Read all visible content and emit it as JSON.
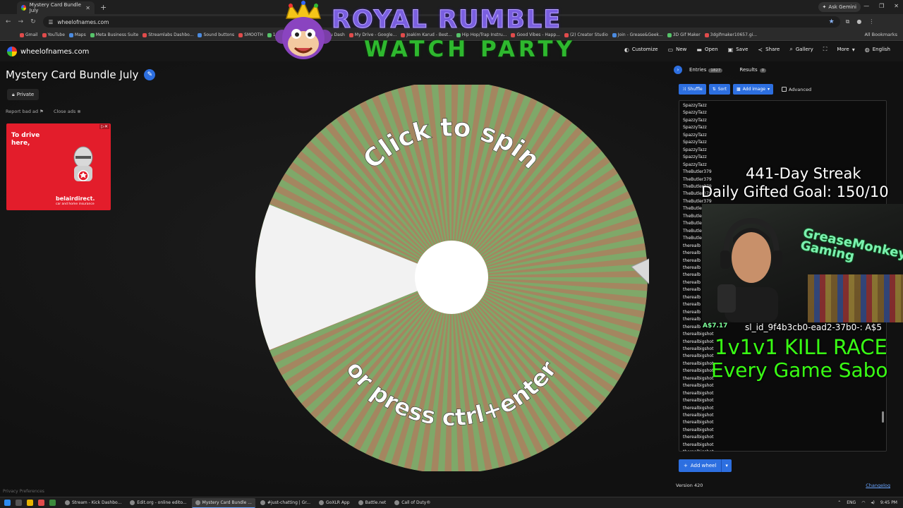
{
  "browser": {
    "tab_title": "Mystery Card Bundle July",
    "url": "wheelofnames.com",
    "ask_gemini": "Ask Gemini",
    "bookmarks": [
      "Gmail",
      "YouTube",
      "Maps",
      "Meta Business Suite",
      "Streamlabs Dashbo...",
      "Sound buttons",
      "SMOOTH",
      "10 HOUR GAMING...",
      "Juju Dash",
      "My Drive - Google...",
      "Joakim Karud - Best...",
      "Hip Hop/Trap Instru...",
      "Good Vibes - Happ...",
      "(2) Creator Studio",
      "Join - Grease&Geek...",
      "3D Gif Maker",
      "3dgifmaker10657.gi..."
    ],
    "all_bookmarks": "All Bookmarks"
  },
  "site": {
    "name": "wheelofnames.com",
    "menu": [
      "Customize",
      "New",
      "Open",
      "Save",
      "Share",
      "Gallery",
      "More",
      "English"
    ]
  },
  "wheel_page": {
    "title": "Mystery Card Bundle July",
    "private": "Private",
    "report_ad": "Report bad ad",
    "close_ads": "Close ads",
    "privacy": "Privacy Preferences",
    "spin_top": "Click to spin",
    "spin_bottom": "or press ctrl+enter"
  },
  "ad": {
    "text": "To drive here,",
    "brand": "belairdirect.",
    "tagline": "car and home insurance"
  },
  "panel": {
    "entries_tab": "Entries",
    "entries_count": "1827",
    "results_tab": "Results",
    "results_count": "0",
    "shuffle": "Shuffle",
    "sort": "Sort",
    "add_image": "Add image",
    "advanced": "Advanced",
    "add_wheel": "Add wheel",
    "version": "Version 420",
    "changelog": "Changelog"
  },
  "entries": [
    "SpazzyTazz",
    "SpazzyTazz",
    "SpazzyTazz",
    "SpazzyTazz",
    "SpazzyTazz",
    "SpazzyTazz",
    "SpazzyTazz",
    "SpazzyTazz",
    "SpazzyTazz",
    "TheButler379",
    "TheButler379",
    "TheButler379",
    "TheButler379",
    "TheButler379",
    "TheButle",
    "TheButle",
    "TheButle",
    "TheButle",
    "TheButle",
    "therealb",
    "therealb",
    "therealb",
    "therealb",
    "therealb",
    "therealb",
    "therealb",
    "therealb",
    "therealb",
    "therealb",
    "therealb",
    "therealb",
    "therealbigshot",
    "therealbigshot",
    "therealbigshot",
    "therealbigshot",
    "therealbigshot",
    "therealbigshot",
    "therealbigshot",
    "therealbigshot",
    "therealbigshot",
    "therealbigshot",
    "therealbigshot",
    "therealbigshot",
    "therealbigshot",
    "therealbigshot",
    "therealbigshot",
    "therealbigshot",
    "therealbigshot"
  ],
  "stream": {
    "title": "ROYAL RUMBLE",
    "subtitle": "WATCH PARTY",
    "streak": "441-Day Streak",
    "goal": "Daily Gifted Goal: 150/10",
    "cam_brand": "GreaseMonkey Gaming",
    "tip": "A$7.17",
    "ticker": "sl_id_9f4b3cb0-ead2-37b0-: A$5",
    "race_line1": "1v1v1 KILL RACE",
    "race_line2": "Every Game Sabo"
  },
  "taskbar": {
    "apps": [
      "Stream - Kick Dashbo...",
      "Edit.org - online edito...",
      "Mystery Card Bundle ...",
      "#just-chatting | Gr...",
      "GoXLR App",
      "Battle.net",
      "Call of Duty®"
    ],
    "lang": "ENG",
    "time": "9:45 PM"
  },
  "colors": {
    "accent": "#2d6fe0",
    "wheel_green": "#7fa869",
    "wheel_red": "#c26a5a",
    "overlay_green": "#39ff14"
  }
}
